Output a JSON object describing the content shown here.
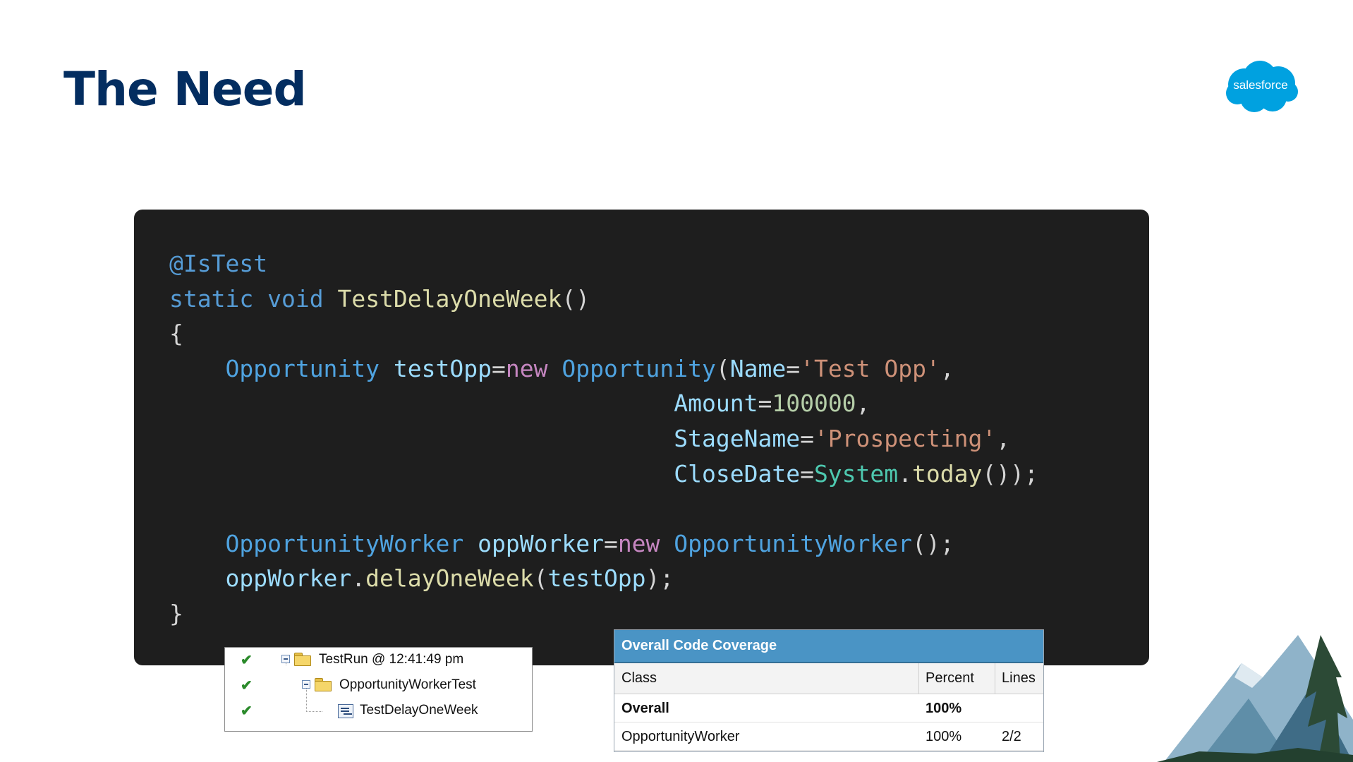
{
  "slide": {
    "title": "The Need",
    "logo_text": "salesforce",
    "brand_color": "#00a1e0",
    "title_color": "#032d60"
  },
  "code": {
    "annotation": "@IsTest",
    "kw_static": "static",
    "kw_void": "void",
    "method_name": "TestDelayOneWeek",
    "parens": "()",
    "open_brace": "{",
    "close_brace": "}",
    "type_opportunity": "Opportunity",
    "var_testopp": "testOpp",
    "kw_new": "new",
    "field_name": "Name",
    "str_test_opp": "'Test Opp'",
    "field_amount": "Amount",
    "num_amount": "100000",
    "field_stage": "StageName",
    "str_prospecting": "'Prospecting'",
    "field_closedate": "CloseDate",
    "cls_system": "System",
    "fn_today": "today",
    "type_worker": "OpportunityWorker",
    "var_oppworker": "oppWorker",
    "fn_delay": "delayOneWeek"
  },
  "test_tree": {
    "items": [
      {
        "label": "TestRun @ 12:41:49 pm",
        "status": "passed",
        "icon": "folder-icon"
      },
      {
        "label": "OpportunityWorkerTest",
        "status": "passed",
        "icon": "folder-icon"
      },
      {
        "label": "TestDelayOneWeek",
        "status": "passed",
        "icon": "test-method-icon"
      }
    ]
  },
  "coverage": {
    "title": "Overall Code Coverage",
    "columns": [
      "Class",
      "Percent",
      "Lines"
    ],
    "rows": [
      {
        "class": "Overall",
        "percent": "100%",
        "lines": ""
      },
      {
        "class": "OpportunityWorker",
        "percent": "100%",
        "lines": "2/2"
      }
    ]
  }
}
